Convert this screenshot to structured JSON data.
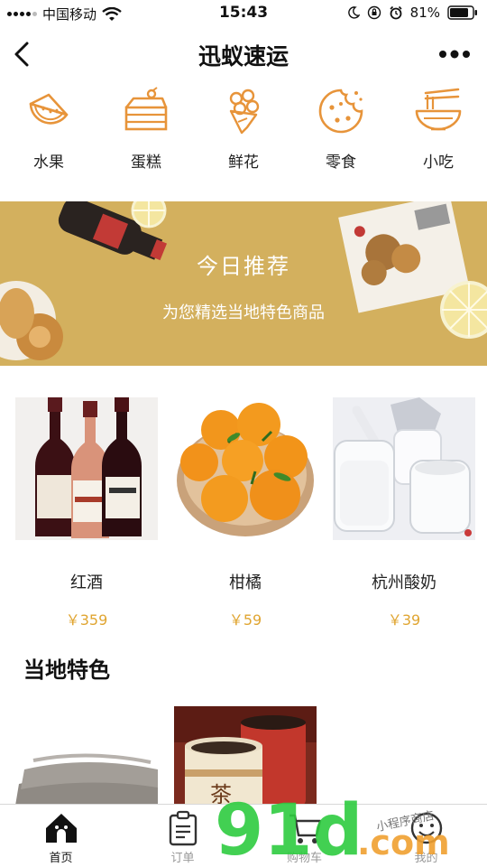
{
  "status_bar": {
    "carrier": "中国移动",
    "time": "15:43",
    "battery": "81%"
  },
  "header": {
    "title": "迅蚁速运"
  },
  "categories": [
    {
      "label": "水果",
      "icon": "watermelon-icon"
    },
    {
      "label": "蛋糕",
      "icon": "cake-icon"
    },
    {
      "label": "鲜花",
      "icon": "flower-bouquet-icon"
    },
    {
      "label": "零食",
      "icon": "cookie-icon"
    },
    {
      "label": "小吃",
      "icon": "noodle-bowl-icon"
    }
  ],
  "banner": {
    "title": "今日推荐",
    "subtitle": "为您精选当地特色商品"
  },
  "products": [
    {
      "name": "红酒",
      "price": "￥359",
      "image": "wine-bottles-photo"
    },
    {
      "name": "柑橘",
      "price": "￥59",
      "image": "mandarin-oranges-photo"
    },
    {
      "name": "杭州酸奶",
      "price": "￥39",
      "image": "yogurt-jars-photo"
    }
  ],
  "section": {
    "title": "当地特色"
  },
  "tabs": [
    {
      "label": "首页",
      "icon": "home-icon",
      "active": true
    },
    {
      "label": "订单",
      "icon": "clipboard-icon",
      "active": false
    },
    {
      "label": "购物车",
      "icon": "cart-icon",
      "active": false
    },
    {
      "label": "我的",
      "icon": "profile-icon",
      "active": false
    }
  ],
  "watermark": {
    "big": "91d.com",
    "small": "小程序商店"
  },
  "colors": {
    "accent_orange": "#e7943a",
    "price": "#e0a531",
    "banner": "#d3b05e",
    "watermark_green": "#2ecc40"
  }
}
